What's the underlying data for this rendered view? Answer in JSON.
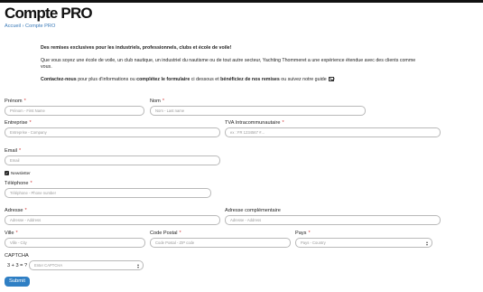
{
  "header": {
    "title": "Compte PRO",
    "breadcrumb": [
      "Accueil",
      "›",
      "Compte PRO"
    ]
  },
  "intro": {
    "headline": "Des remises exclusives pour les industriels, professionnels, clubs et école de voile!",
    "body": "Que vous soyez une école de voile, un club nautique, un industriel du nautisme ou de tout autre secteur, Yachting Thommeret a une expérience étendue avec des clients comme vous.",
    "contact": {
      "part1": "Contactez-nous",
      "part2": " pour plus d'informations ou ",
      "part3": "complétez le formulaire",
      "part4": " ci dessous et ",
      "part5": "bénéficiez de nos remises",
      "part6": " ou suivez notre guide"
    }
  },
  "form": {
    "required_mark": "*",
    "prenom": {
      "label": "Prénom",
      "placeholder": "Prénom - First Name"
    },
    "nom": {
      "label": "Nom",
      "placeholder": "Nom - Last name"
    },
    "entreprise": {
      "label": "Entreprise",
      "placeholder": "Entreprise - Company"
    },
    "tva": {
      "label": "TVA Intracommunautaire",
      "placeholder": "ex : FR 1234567 #..."
    },
    "email": {
      "label": "Email",
      "placeholder": "Email"
    },
    "newsletter": {
      "label": "Newsletter",
      "checked": true
    },
    "telephone": {
      "label": "Téléphone",
      "placeholder": "Téléphone - Phone number"
    },
    "adresse": {
      "label": "Adresse",
      "placeholder": "Adresse - Address"
    },
    "adresse2": {
      "label": "Adresse complémentaire",
      "placeholder": "Adresse - Address"
    },
    "ville": {
      "label": "Ville",
      "placeholder": "Ville - City"
    },
    "code_postal": {
      "label": "Code Postal",
      "placeholder": "Code Postal - ZIP code"
    },
    "pays": {
      "label": "Pays",
      "placeholder": "Pays - Country"
    },
    "captcha": {
      "label": "CAPTCHA",
      "question": "3 + 3 = ?",
      "placeholder": "Enter CAPTCHA"
    },
    "submit_label": "Submit"
  }
}
